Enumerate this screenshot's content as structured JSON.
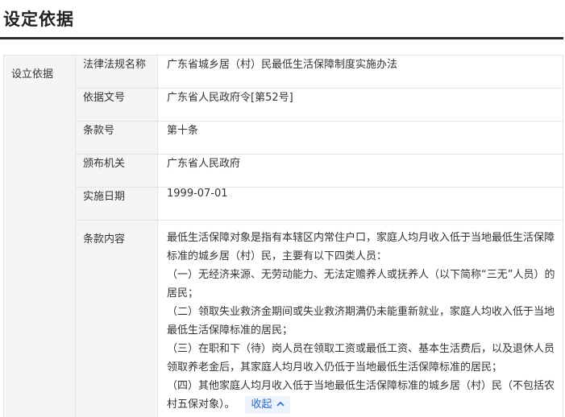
{
  "section": {
    "title": "设定依据"
  },
  "table": {
    "group_label": "设立依据",
    "rows": [
      {
        "label": "法律法规名称",
        "value": "广东省城乡居（村）民最低生活保障制度实施办法"
      },
      {
        "label": "依据文号",
        "value": "广东省人民政府令[第52号]"
      },
      {
        "label": "条款号",
        "value": "第十条"
      },
      {
        "label": "颁布机关",
        "value": "广东省人民政府"
      },
      {
        "label": "实施日期",
        "value": "1999-07-01"
      }
    ],
    "content": {
      "label": "条款内容",
      "paragraphs": [
        "最低生活保障对象是指有本辖区内常住户口，家庭人均月收入低于当地最低生活保障标准的城乡居（村）民，主要有以下四类人员：",
        "（一）无经济来源、无劳动能力、无法定赡养人或抚养人（以下简称“三无”人员）的居民；",
        "（二）领取失业救济金期间或失业救济期满仍未能重新就业，家庭人均收入低于当地最低生活保障标准的居民；",
        "（三）在职和下（待）岗人员在领取工资或最低工资、基本生活费后，以及退休人员领取养老金后，其家庭人均月收入仍低于当地最低生活保障标准的居民；",
        "（四）其他家庭人均月收入低于当地最低生活保障标准的城乡居（村）民（不包括农村五保对象）。"
      ],
      "collapse_label": "收起",
      "collapse_icon": "chevron-up-icon"
    }
  },
  "colors": {
    "label_bg": "#f5f5f5",
    "border": "#e4e4e4",
    "link": "#2e6bc6",
    "title_rule": "#2b2b2b"
  }
}
